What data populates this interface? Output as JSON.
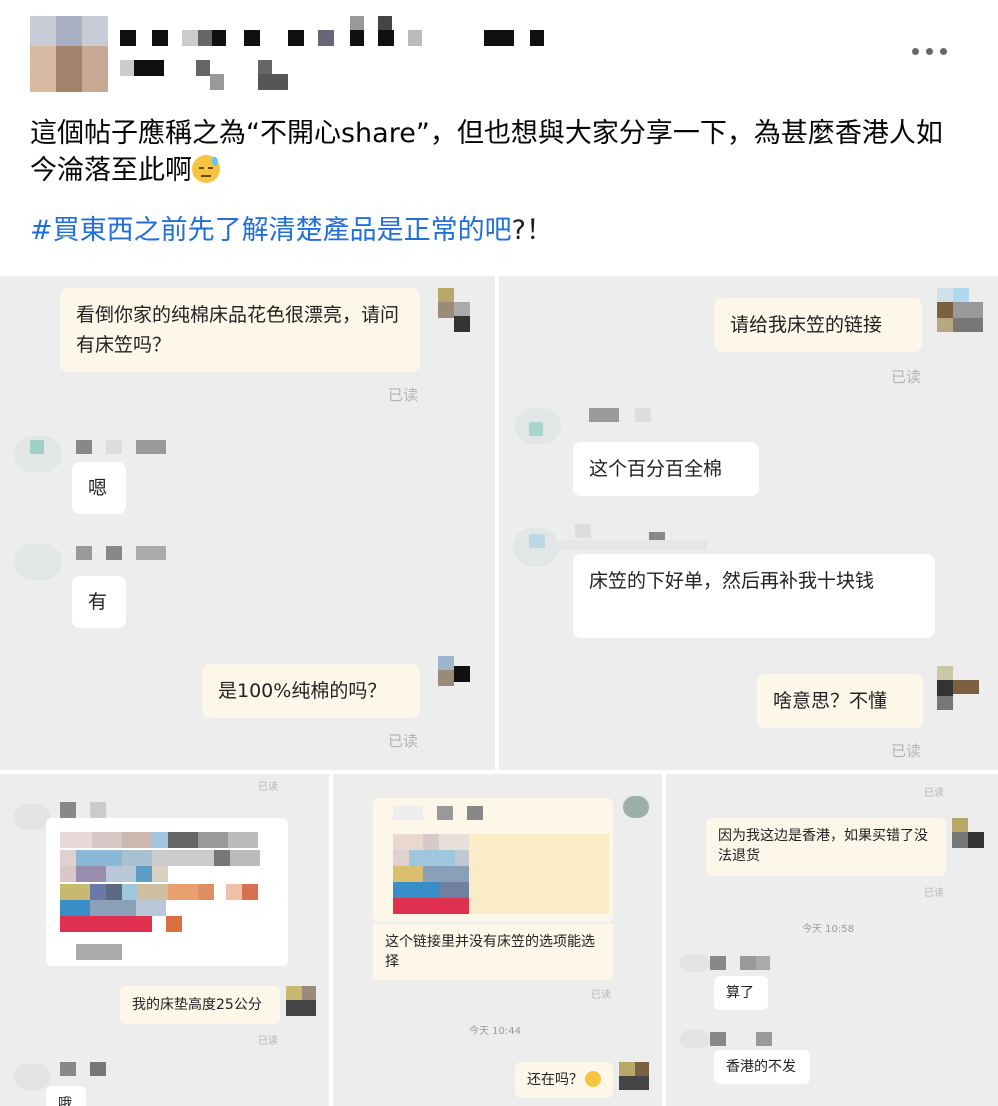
{
  "post": {
    "text": "這個帖子應稱之為“不開心share”，但也想與大家分享一下，為甚麼香港人如今淪落至此啊",
    "emoji": "downcast-face-with-sweat-emoji",
    "hashtag": "#買東西之前先了解清楚產品是正常的吧",
    "hashtag_tail": "?！"
  },
  "colors": {
    "accent": "#216fdb",
    "my_bubble": "#fdf7e9",
    "their_bubble": "#ffffff",
    "chat_bg": "#ededed"
  },
  "chat1": {
    "msg1": "看倒你家的纯棉床品花色很漂亮，请问有床笠吗？",
    "read1": "已读",
    "msg2": "嗯",
    "msg3": "有",
    "msg4": "是100%纯棉的吗？",
    "read2": "已读"
  },
  "chat2": {
    "msg1": "请给我床笠的链接",
    "read1": "已读",
    "msg2": "这个百分百全棉",
    "msg3": "床笠的下好单，然后再补我十块钱",
    "msg4": "啥意思？不懂",
    "read2": "已读"
  },
  "chat3": {
    "read_top": "已读",
    "msg1": "我的床垫高度25公分",
    "read1": "已读",
    "msg2": "哦"
  },
  "chat4": {
    "msg1": "这个链接里并没有床笠的选项能选择",
    "read1": "已读",
    "time": "今天 10:44",
    "msg2": "还在吗？",
    "emoji": "thinking-face-emoji"
  },
  "chat5": {
    "read_top": "已读",
    "msg1": "因为我这边是香港，如果买错了没法退货",
    "read1": "已读",
    "time": "今天 10:58",
    "msg2": "算了",
    "msg3": "香港的不发"
  }
}
